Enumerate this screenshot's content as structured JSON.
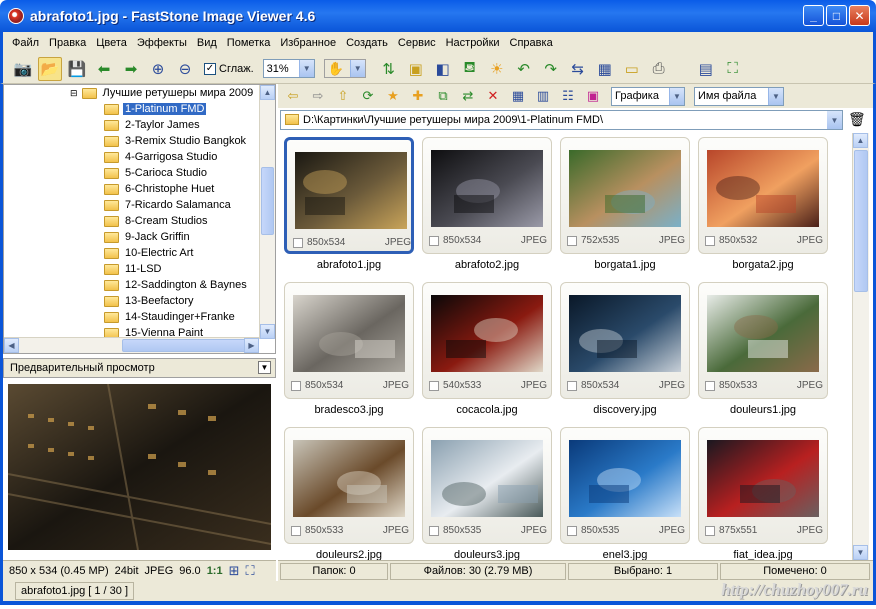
{
  "window": {
    "title": "abrafoto1.jpg  -  FastStone Image Viewer 4.6"
  },
  "menu": [
    "Файл",
    "Правка",
    "Цвета",
    "Эффекты",
    "Вид",
    "Пометка",
    "Избранное",
    "Создать",
    "Сервис",
    "Настройки",
    "Справка"
  ],
  "toolbar": {
    "smooth_label": "Сглаж.",
    "smooth_checked": "✓",
    "zoom": "31%"
  },
  "tree": {
    "parent": "Лучшие ретушеры мира 2009",
    "items": [
      "1-Platinum FMD",
      "2-Taylor James",
      "3-Remix Studio Bangkok",
      "4-Garrigosa Studio",
      "5-Carioca Studio",
      "6-Christophe Huet",
      "7-Ricardo Salamanca",
      "8-Cream Studios",
      "9-Jack Griffin",
      "10-Electric Art",
      "11-LSD",
      "12-Saddington & Baynes",
      "13-Beefactory",
      "14-Staudinger+Franke",
      "15-Vienna Paint"
    ],
    "selected_index": 0
  },
  "preview": {
    "title": "Предварительный просмотр"
  },
  "info": {
    "dims": "850 x 534 (0.45 MP)",
    "bits": "24bit",
    "format": "JPEG",
    "extra": "96.0",
    "ratio": "1:1"
  },
  "browser": {
    "filter": "Графика",
    "sort": "Имя файла",
    "path": "D:\\Картинки\\Лучшие ретушеры мира 2009\\1-Platinum FMD\\"
  },
  "thumbnails": [
    {
      "name": "abrafoto1.jpg",
      "dims": "850x534",
      "fmt": "JPEG",
      "colors": [
        "#1a1812",
        "#6b5a3a",
        "#c9a45a"
      ]
    },
    {
      "name": "abrafoto2.jpg",
      "dims": "850x534",
      "fmt": "JPEG",
      "colors": [
        "#0e0e10",
        "#4a4a52",
        "#9a9aa8"
      ]
    },
    {
      "name": "borgata1.jpg",
      "dims": "752x535",
      "fmt": "JPEG",
      "colors": [
        "#3a6a2a",
        "#b89060",
        "#7ab0c8"
      ]
    },
    {
      "name": "borgata2.jpg",
      "dims": "850x532",
      "fmt": "JPEG",
      "colors": [
        "#b8462a",
        "#f0a060",
        "#4a2018"
      ]
    },
    {
      "name": "bradesco3.jpg",
      "dims": "850x534",
      "fmt": "JPEG",
      "colors": [
        "#d8d4cc",
        "#6a6660",
        "#a8a49c"
      ]
    },
    {
      "name": "cocacola.jpg",
      "dims": "540x533",
      "fmt": "JPEG",
      "colors": [
        "#0a0808",
        "#8a1a10",
        "#e0d8c8"
      ]
    },
    {
      "name": "discovery.jpg",
      "dims": "850x534",
      "fmt": "JPEG",
      "colors": [
        "#0a1828",
        "#2a4a6a",
        "#c8d0d8"
      ]
    },
    {
      "name": "douleurs1.jpg",
      "dims": "850x533",
      "fmt": "JPEG",
      "colors": [
        "#e8ece8",
        "#4a6a3a",
        "#8a6a4a"
      ]
    },
    {
      "name": "douleurs2.jpg",
      "dims": "850x533",
      "fmt": "JPEG",
      "colors": [
        "#c8c4b8",
        "#6a4a2a",
        "#e0d8c8"
      ]
    },
    {
      "name": "douleurs3.jpg",
      "dims": "850x535",
      "fmt": "JPEG",
      "colors": [
        "#8aa0b0",
        "#e8ecf0",
        "#4a5a5a"
      ]
    },
    {
      "name": "enel3.jpg",
      "dims": "850x535",
      "fmt": "JPEG",
      "colors": [
        "#0a3a7a",
        "#2a7ac8",
        "#c8e0f8"
      ]
    },
    {
      "name": "fiat_idea.jpg",
      "dims": "875x551",
      "fmt": "JPEG",
      "colors": [
        "#1a1820",
        "#b82020",
        "#6a6060"
      ]
    }
  ],
  "selected_thumb": 0,
  "status": {
    "folders": "Папок: 0",
    "files": "Файлов: 30 (2.79 MB)",
    "selected": "Выбрано: 1",
    "marked": "Помечено: 0"
  },
  "bottom": {
    "file": "abrafoto1.jpg [ 1 / 30 ]"
  },
  "watermark": "http://chuzhoy007.ru",
  "colors": {
    "title_bar": "#0a55d8",
    "selection": "#316ac5",
    "panel": "#ece9d8"
  }
}
